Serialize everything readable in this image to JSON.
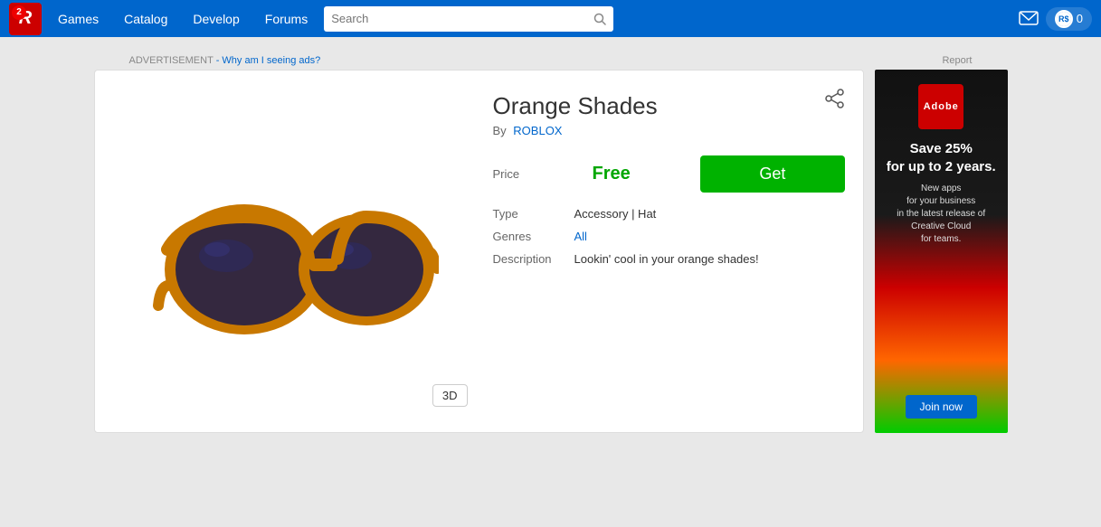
{
  "nav": {
    "notification_count": "2",
    "logo_letter": "R",
    "links": [
      "Games",
      "Catalog",
      "Develop",
      "Forums"
    ],
    "search_placeholder": "Search",
    "robux_label": "R$",
    "robux_amount": "0"
  },
  "ad": {
    "label": "ADVERTISEMENT",
    "why_text": "- Why am I seeing ads?",
    "report": "Report"
  },
  "item": {
    "title": "Orange Shades",
    "by_label": "By",
    "seller": "ROBLOX",
    "price_label": "Price",
    "price_value": "Free",
    "get_label": "Get",
    "type_label": "Type",
    "type_value": "Accessory | Hat",
    "genres_label": "Genres",
    "genres_value": "All",
    "desc_label": "Description",
    "desc_value": "Lookin' cool in your orange shades!",
    "view_3d": "3D"
  },
  "adobe_ad": {
    "logo_text": "Adobe",
    "headline": "Save 25%\nfor up to 2 years.",
    "sub": "New apps\nfor your business\nin the latest release of\nCreative Cloud\nfor teams.",
    "join_btn": "Join now"
  }
}
